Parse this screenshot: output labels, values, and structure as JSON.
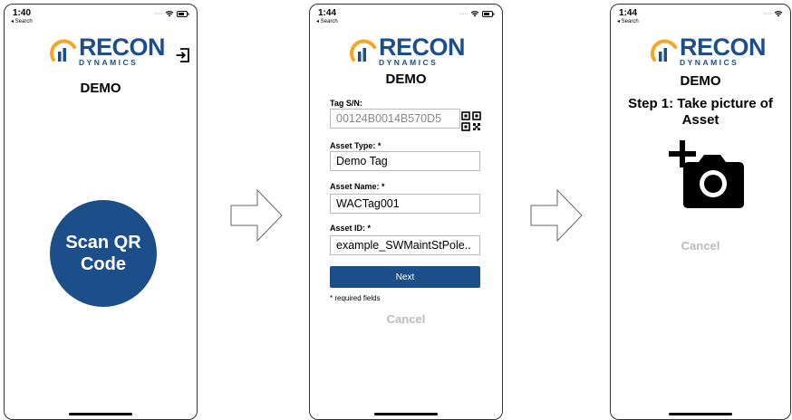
{
  "status": {
    "screen1_time": "1:40",
    "screen2_time": "1:44",
    "screen3_time": "1:44",
    "back_label": "◂ Search"
  },
  "logo": {
    "word": "RECON",
    "sub": "DYNAMICS"
  },
  "demo_label": "DEMO",
  "screen1": {
    "scan_line1": "Scan QR",
    "scan_line2": "Code"
  },
  "screen2": {
    "tag_label": "Tag S/N:",
    "tag_value": "00124B0014B570D5",
    "asset_type_label": "Asset Type: *",
    "asset_type_value": "Demo Tag",
    "asset_name_label": "Asset Name: *",
    "asset_name_value": "WACTag001",
    "asset_id_label": "Asset ID: *",
    "asset_id_value": "example_SWMaintStPole..",
    "next_label": "Next",
    "required_note": "* required fields",
    "cancel_label": "Cancel"
  },
  "screen3": {
    "step_line1": "Step 1: Take picture of",
    "step_line2": "Asset",
    "cancel_label": "Cancel"
  },
  "colors": {
    "brand_blue": "#1c4f8a",
    "logo_orange": "#f5a623",
    "cancel_gray": "#bbbbbb"
  },
  "icons": [
    "wifi-icon",
    "battery-icon",
    "exit-icon",
    "qr-code-icon",
    "add-camera-icon",
    "arrow-right-icon"
  ]
}
